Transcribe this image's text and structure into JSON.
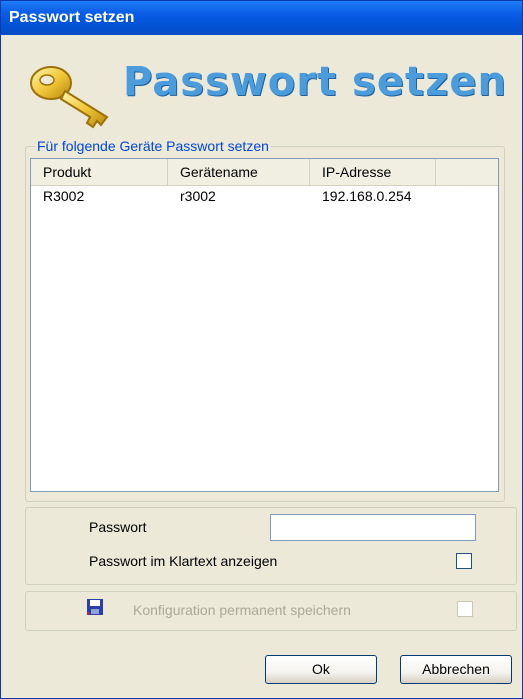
{
  "window": {
    "title": "Passwort setzen"
  },
  "header": {
    "title": "Passwort setzen",
    "icon": "key-icon"
  },
  "devices": {
    "group_label": "Für folgende Geräte Passwort setzen",
    "columns": [
      "Produkt",
      "Gerätename",
      "IP-Adresse"
    ],
    "rows": [
      {
        "product": "R3002",
        "device_name": "r3002",
        "ip": "192.168.0.254"
      }
    ]
  },
  "password": {
    "label": "Passwort",
    "value": "",
    "show_plain_label": "Passwort im Klartext anzeigen",
    "show_plain_checked": false
  },
  "config": {
    "label": "Konfiguration permanent speichern",
    "checked": false,
    "enabled": false,
    "icon": "floppy-disk-icon"
  },
  "buttons": {
    "ok": "Ok",
    "cancel": "Abbrechen"
  },
  "colors": {
    "title_bar": "#0a5ee6",
    "header_text": "#4a9cdc",
    "group_label": "#0046d5"
  }
}
